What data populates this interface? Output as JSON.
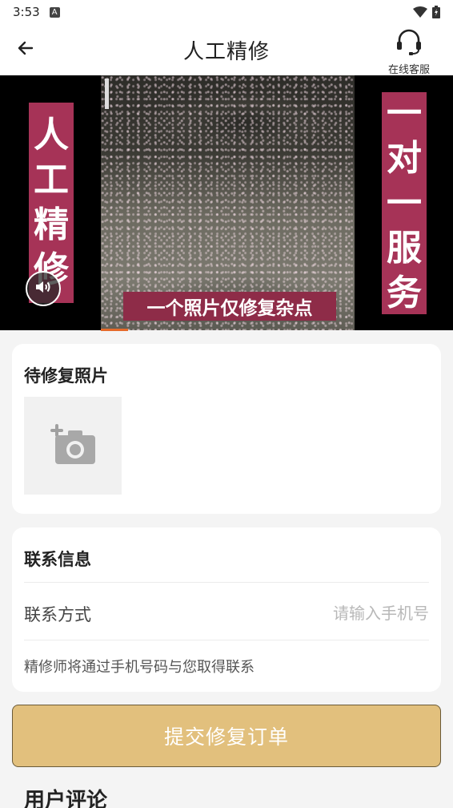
{
  "status_bar": {
    "time": "3:53",
    "notification_icon": "a-icon",
    "icons": [
      "wifi-icon",
      "battery-icon"
    ]
  },
  "app_bar": {
    "title": "人工精修",
    "back_icon": "arrow-left-icon",
    "service_icon": "headset-icon",
    "service_label": "在线客服"
  },
  "video": {
    "left_banner": [
      "人",
      "工",
      "精",
      "修"
    ],
    "right_banner": [
      "一",
      "对",
      "一",
      "服",
      "务"
    ],
    "caption": "一个照片仅修复杂点",
    "mute_icon": "speaker-icon"
  },
  "photo_section": {
    "title": "待修复照片",
    "upload_icon": "add-photo-icon"
  },
  "contact_section": {
    "title": "联系信息",
    "field_label": "联系方式",
    "phone_value": "",
    "phone_placeholder": "请输入手机号",
    "hint": "精修师将通过手机号码与您取得联系"
  },
  "submit_label": "提交修复订单",
  "reviews_title": "用户评论",
  "colors": {
    "banner": "#a63357",
    "caption_bg": "#8e2c48",
    "submit_bg": "#e2c07d",
    "progress": "#e56a2a"
  }
}
